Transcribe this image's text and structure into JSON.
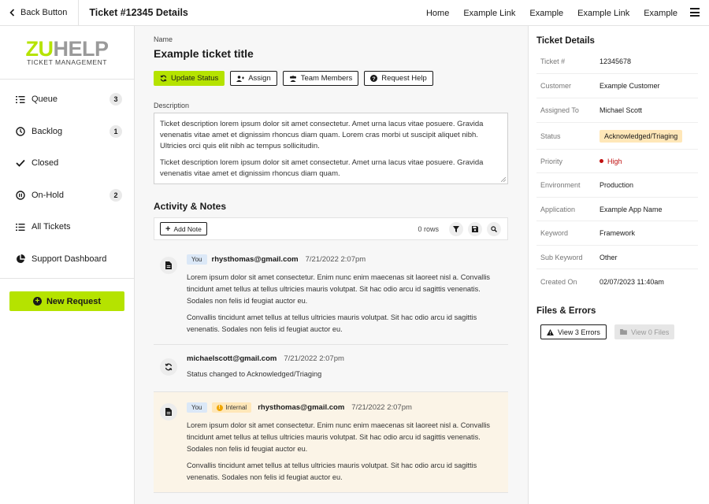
{
  "topbar": {
    "back_label": "Back Button",
    "title": "Ticket #12345 Details",
    "nav": [
      "Home",
      "Example Link",
      "Example",
      "Example Link",
      "Example"
    ]
  },
  "logo": {
    "zu": "ZU",
    "help": "HELP",
    "sub": "TICKET MANAGEMENT"
  },
  "sidebar": {
    "items": [
      {
        "label": "Queue",
        "badge": "3",
        "icon": "queue-icon"
      },
      {
        "label": "Backlog",
        "badge": "1",
        "icon": "clock-icon"
      },
      {
        "label": "Closed",
        "badge": "",
        "icon": "check-icon"
      },
      {
        "label": "On-Hold",
        "badge": "2",
        "icon": "pause-icon"
      },
      {
        "label": "All Tickets",
        "badge": "",
        "icon": "list-icon"
      },
      {
        "label": "Support Dashboard",
        "badge": "",
        "icon": "pie-chart-icon"
      }
    ],
    "new_request": "New Request"
  },
  "main": {
    "name_label": "Name",
    "title": "Example ticket title",
    "actions": {
      "update_status": "Update Status",
      "assign": "Assign",
      "team_members": "Team Members",
      "request_help": "Request Help"
    },
    "description_label": "Description",
    "description": [
      "Ticket description lorem ipsum dolor sit amet consectetur. Amet urna lacus vitae posuere. Gravida venenatis vitae amet et dignissim rhoncus diam quam. Lorem cras morbi ut suscipit aliquet nibh. Ultricies orci quis elit nibh ac tempus sollicitudin.",
      "Ticket description lorem ipsum dolor sit amet consectetur. Amet urna lacus vitae posuere. Gravida venenatis vitae amet et dignissim rhoncus diam quam."
    ],
    "activity_title": "Activity & Notes",
    "add_note": "Add Note",
    "rows": "0 rows",
    "entries": [
      {
        "tag_you": "You",
        "email": "rhysthomas@gmail.com",
        "date": "7/21/2022 2:07pm",
        "p1": "Lorem ipsum dolor sit amet consectetur. Enim nunc enim maecenas sit laoreet nisl a. Convallis tincidunt amet tellus at tellus ultricies mauris volutpat. Sit hac odio arcu id sagittis venenatis. Sodales non felis id feugiat auctor eu.",
        "p2": "Convallis tincidunt amet tellus at tellus ultricies mauris volutpat. Sit hac odio arcu id sagittis venenatis. Sodales non felis id feugiat auctor eu."
      },
      {
        "email": "michaelscott@gmail.com",
        "date": "7/21/2022 2:07pm",
        "p1": "Status changed to Acknowledged/Triaging"
      },
      {
        "tag_you": "You",
        "tag_internal": "Internal",
        "email": "rhysthomas@gmail.com",
        "date": "7/21/2022 2:07pm",
        "p1": "Lorem ipsum dolor sit amet consectetur. Enim nunc enim maecenas sit laoreet nisl a. Convallis tincidunt amet tellus at tellus ultricies mauris volutpat. Sit hac odio arcu id sagittis venenatis. Sodales non felis id feugiat auctor eu.",
        "p2": "Convallis tincidunt amet tellus at tellus ultricies mauris volutpat. Sit hac odio arcu id sagittis venenatis. Sodales non felis id feugiat auctor eu."
      }
    ]
  },
  "details": {
    "title": "Ticket Details",
    "rows": [
      {
        "label": "Ticket #",
        "value": "12345678"
      },
      {
        "label": "Customer",
        "value": "Example Customer"
      },
      {
        "label": "Assigned To",
        "value": "Michael Scott"
      },
      {
        "label": "Status",
        "value": "Acknowledged/Triaging"
      },
      {
        "label": "Priority",
        "value": "High"
      },
      {
        "label": "Environment",
        "value": "Production"
      },
      {
        "label": "Application",
        "value": "Example App Name"
      },
      {
        "label": "Keyword",
        "value": "Framework"
      },
      {
        "label": "Sub Keyword",
        "value": "Other"
      },
      {
        "label": "Created On",
        "value": "02/07/2023 11:40am"
      }
    ],
    "files_title": "Files & Errors",
    "view_errors": "View 3 Errors",
    "view_files": "View 0 Files"
  },
  "colors": {
    "accent": "#b5e300",
    "status_bg": "#ffe7b8",
    "priority_high": "#c01010",
    "internal_bg": "#fbf4e7",
    "you_tag_bg": "#dbe8f7"
  }
}
